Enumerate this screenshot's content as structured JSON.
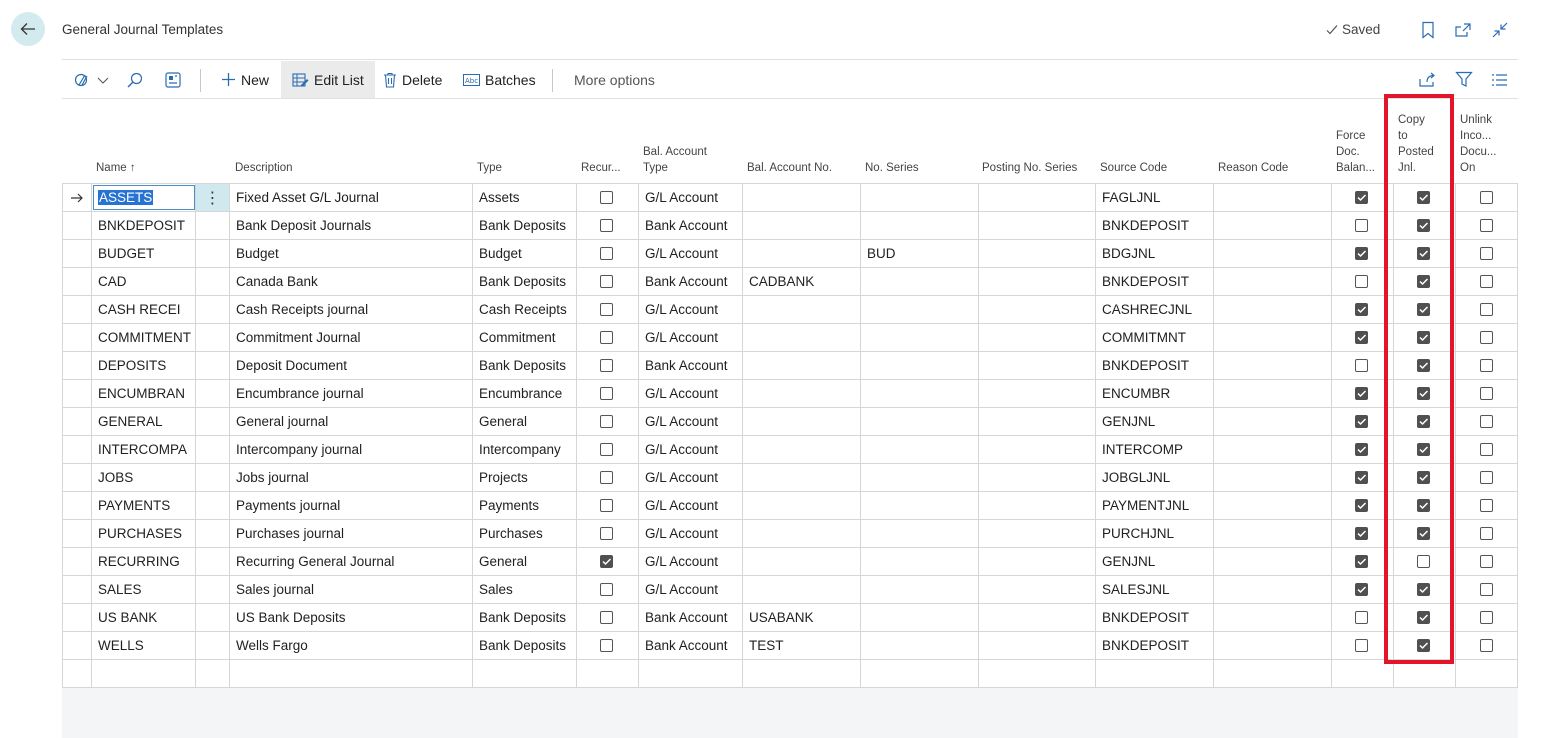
{
  "header": {
    "title": "General Journal Templates",
    "saved_label": "Saved"
  },
  "toolbar": {
    "new_label": "New",
    "edit_list_label": "Edit List",
    "delete_label": "Delete",
    "batches_label": "Batches",
    "more_options_label": "More options"
  },
  "columns": {
    "name": "Name",
    "name_sort": "↑",
    "description": "Description",
    "type": "Type",
    "recurring": "Recur...",
    "bal_account_type_1": "Bal. Account",
    "bal_account_type_2": "Type",
    "bal_account_no": "Bal. Account No.",
    "no_series": "No. Series",
    "posting_no_series": "Posting No. Series",
    "source_code": "Source Code",
    "reason_code": "Reason Code",
    "force_doc_1": "Force",
    "force_doc_2": "Doc.",
    "force_doc_3": "Balan...",
    "copy_posted_1": "Copy",
    "copy_posted_2": "to",
    "copy_posted_3": "Posted",
    "copy_posted_4": "Jnl.",
    "unlink_1": "Unlink",
    "unlink_2": "Inco...",
    "unlink_3": "Docu...",
    "unlink_4": "On"
  },
  "rows": [
    {
      "name": "ASSETS",
      "description": "Fixed Asset G/L Journal",
      "type": "Assets",
      "recurring": false,
      "bal_type": "G/L Account",
      "bal_no": "",
      "no_series": "",
      "posting_series": "",
      "source_code": "FAGLJNL",
      "reason_code": "",
      "force_doc": true,
      "copy_posted": true,
      "unlink": false
    },
    {
      "name": "BNKDEPOSIT",
      "description": "Bank Deposit Journals",
      "type": "Bank Deposits",
      "recurring": false,
      "bal_type": "Bank Account",
      "bal_no": "",
      "no_series": "",
      "posting_series": "",
      "source_code": "BNKDEPOSIT",
      "reason_code": "",
      "force_doc": false,
      "copy_posted": true,
      "unlink": false
    },
    {
      "name": "BUDGET",
      "description": "Budget",
      "type": "Budget",
      "recurring": false,
      "bal_type": "G/L Account",
      "bal_no": "",
      "no_series": "BUD",
      "posting_series": "",
      "source_code": "BDGJNL",
      "reason_code": "",
      "force_doc": true,
      "copy_posted": true,
      "unlink": false
    },
    {
      "name": "CAD",
      "description": "Canada Bank",
      "type": "Bank Deposits",
      "recurring": false,
      "bal_type": "Bank Account",
      "bal_no": "CADBANK",
      "no_series": "",
      "posting_series": "",
      "source_code": "BNKDEPOSIT",
      "reason_code": "",
      "force_doc": false,
      "copy_posted": true,
      "unlink": false
    },
    {
      "name": "CASH RECEI",
      "description": "Cash Receipts journal",
      "type": "Cash Receipts",
      "recurring": false,
      "bal_type": "G/L Account",
      "bal_no": "",
      "no_series": "",
      "posting_series": "",
      "source_code": "CASHRECJNL",
      "reason_code": "",
      "force_doc": true,
      "copy_posted": true,
      "unlink": false
    },
    {
      "name": "COMMITMENT",
      "description": "Commitment Journal",
      "type": "Commitment",
      "recurring": false,
      "bal_type": "G/L Account",
      "bal_no": "",
      "no_series": "",
      "posting_series": "",
      "source_code": "COMMITMNT",
      "reason_code": "",
      "force_doc": true,
      "copy_posted": true,
      "unlink": false
    },
    {
      "name": "DEPOSITS",
      "description": "Deposit Document",
      "type": "Bank Deposits",
      "recurring": false,
      "bal_type": "Bank Account",
      "bal_no": "",
      "no_series": "",
      "posting_series": "",
      "source_code": "BNKDEPOSIT",
      "reason_code": "",
      "force_doc": false,
      "copy_posted": true,
      "unlink": false
    },
    {
      "name": "ENCUMBRAN",
      "description": "Encumbrance journal",
      "type": "Encumbrance",
      "recurring": false,
      "bal_type": "G/L Account",
      "bal_no": "",
      "no_series": "",
      "posting_series": "",
      "source_code": "ENCUMBR",
      "reason_code": "",
      "force_doc": true,
      "copy_posted": true,
      "unlink": false
    },
    {
      "name": "GENERAL",
      "description": "General journal",
      "type": "General",
      "recurring": false,
      "bal_type": "G/L Account",
      "bal_no": "",
      "no_series": "",
      "posting_series": "",
      "source_code": "GENJNL",
      "reason_code": "",
      "force_doc": true,
      "copy_posted": true,
      "unlink": false
    },
    {
      "name": "INTERCOMPA",
      "description": "Intercompany journal",
      "type": "Intercompany",
      "recurring": false,
      "bal_type": "G/L Account",
      "bal_no": "",
      "no_series": "",
      "posting_series": "",
      "source_code": "INTERCOMP",
      "reason_code": "",
      "force_doc": true,
      "copy_posted": true,
      "unlink": false
    },
    {
      "name": "JOBS",
      "description": "Jobs journal",
      "type": "Projects",
      "recurring": false,
      "bal_type": "G/L Account",
      "bal_no": "",
      "no_series": "",
      "posting_series": "",
      "source_code": "JOBGLJNL",
      "reason_code": "",
      "force_doc": true,
      "copy_posted": true,
      "unlink": false
    },
    {
      "name": "PAYMENTS",
      "description": "Payments journal",
      "type": "Payments",
      "recurring": false,
      "bal_type": "G/L Account",
      "bal_no": "",
      "no_series": "",
      "posting_series": "",
      "source_code": "PAYMENTJNL",
      "reason_code": "",
      "force_doc": true,
      "copy_posted": true,
      "unlink": false
    },
    {
      "name": "PURCHASES",
      "description": "Purchases journal",
      "type": "Purchases",
      "recurring": false,
      "bal_type": "G/L Account",
      "bal_no": "",
      "no_series": "",
      "posting_series": "",
      "source_code": "PURCHJNL",
      "reason_code": "",
      "force_doc": true,
      "copy_posted": true,
      "unlink": false
    },
    {
      "name": "RECURRING",
      "description": "Recurring General Journal",
      "type": "General",
      "recurring": true,
      "bal_type": "G/L Account",
      "bal_no": "",
      "no_series": "",
      "posting_series": "",
      "source_code": "GENJNL",
      "reason_code": "",
      "force_doc": true,
      "copy_posted": false,
      "unlink": false
    },
    {
      "name": "SALES",
      "description": "Sales journal",
      "type": "Sales",
      "recurring": false,
      "bal_type": "G/L Account",
      "bal_no": "",
      "no_series": "",
      "posting_series": "",
      "source_code": "SALESJNL",
      "reason_code": "",
      "force_doc": true,
      "copy_posted": true,
      "unlink": false
    },
    {
      "name": "US BANK",
      "description": "US Bank Deposits",
      "type": "Bank Deposits",
      "recurring": false,
      "bal_type": "Bank Account",
      "bal_no": "USABANK",
      "no_series": "",
      "posting_series": "",
      "source_code": "BNKDEPOSIT",
      "reason_code": "",
      "force_doc": false,
      "copy_posted": true,
      "unlink": false
    },
    {
      "name": "WELLS",
      "description": "Wells Fargo",
      "type": "Bank Deposits",
      "recurring": false,
      "bal_type": "Bank Account",
      "bal_no": "TEST",
      "no_series": "",
      "posting_series": "",
      "source_code": "BNKDEPOSIT",
      "reason_code": "",
      "force_doc": false,
      "copy_posted": true,
      "unlink": false
    }
  ],
  "selected_row": 0,
  "colors": {
    "accent": "#2773d4",
    "highlight_box": "#e3152a",
    "back_button_bg": "#d3ebef",
    "active_cell_bg": "#cfe9ee"
  }
}
